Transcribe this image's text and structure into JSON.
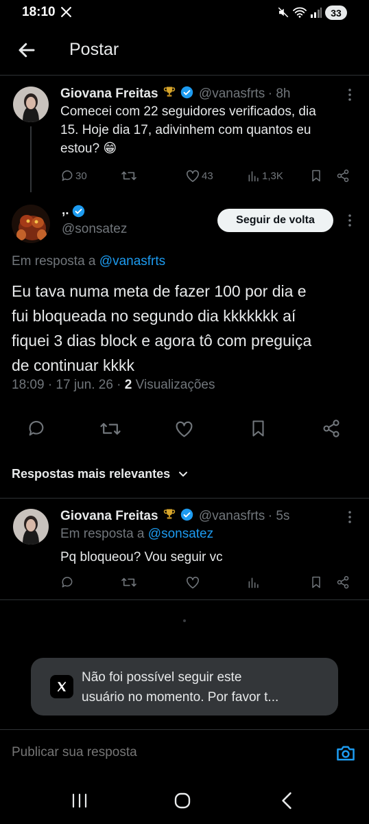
{
  "status_bar": {
    "time": "18:10",
    "battery": "33"
  },
  "header": {
    "title": "Postar"
  },
  "parent_tweet": {
    "name": "Giovana Freitas",
    "handle": "@vanasfrts",
    "time": "· 8h",
    "text_lines": [
      "Comecei com 22 seguidores verificados, dia",
      "15. Hoje dia 17, adivinhem com quantos eu",
      "estou? 😁"
    ],
    "replies": "30",
    "likes": "43",
    "views": "1,3K"
  },
  "main_tweet": {
    "name": ",.",
    "handle": "@sonsatez",
    "follow_label": "Seguir de volta",
    "reply_to_prefix": "Em resposta a",
    "reply_to_handle": "@vanasfrts",
    "text_lines": [
      "Eu tava numa meta de fazer 100 por dia e",
      "fui bloqueada no segundo dia kkkkkkk aí",
      "fiquei 3 dias block e agora tô com preguiça",
      "de continuar kkkk"
    ],
    "meta_time": "18:09 · 17 jun. 26 ·",
    "views_count": "2",
    "views_label": "Visualizações"
  },
  "replies_sort": {
    "label": "Respostas mais relevantes"
  },
  "reply_tweet": {
    "name": "Giovana Freitas",
    "handle": "@vanasfrts",
    "time": "· 5s",
    "reply_to_prefix": "Em resposta a",
    "reply_to_handle": "@sonsatez",
    "text": "Pq bloqueou? Vou seguir vc"
  },
  "toast": {
    "line1": "Não foi possível seguir este",
    "line2": "usuário no momento. Por favor t..."
  },
  "composer": {
    "placeholder": "Publicar sua resposta"
  },
  "colors": {
    "accent": "#1d9bf0",
    "background": "#000000",
    "muted": "#71767b"
  }
}
